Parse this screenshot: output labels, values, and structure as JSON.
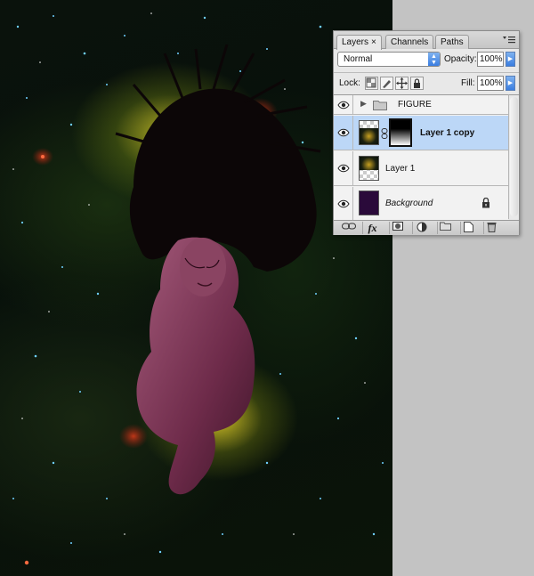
{
  "panel": {
    "tabs": [
      {
        "label": "Layers",
        "close": "×",
        "active": true
      },
      {
        "label": "Channels",
        "active": false
      },
      {
        "label": "Paths",
        "active": false
      }
    ],
    "blend_mode": "Normal",
    "opacity_label": "Opacity:",
    "opacity_value": "100%",
    "lock_label": "Lock:",
    "fill_label": "Fill:",
    "fill_value": "100%",
    "layers": [
      {
        "name": "FIGURE",
        "type": "group",
        "visible": true,
        "selected": false
      },
      {
        "name": "Layer 1 copy",
        "type": "layer-with-mask",
        "visible": true,
        "selected": true
      },
      {
        "name": "Layer 1",
        "type": "layer",
        "visible": true,
        "selected": false
      },
      {
        "name": "Background",
        "type": "background",
        "visible": true,
        "selected": false,
        "locked": true
      }
    ],
    "bottom_buttons": [
      "link-icon",
      "fx-icon",
      "add-mask-icon",
      "adjustment-icon",
      "new-group-icon",
      "new-layer-icon",
      "trash-icon"
    ],
    "fx_label": "fx"
  },
  "colors": {
    "selected_row": "#bcd7f7",
    "accent_blue": "#3a7de0",
    "background_thumb": "#2a0a3a"
  }
}
